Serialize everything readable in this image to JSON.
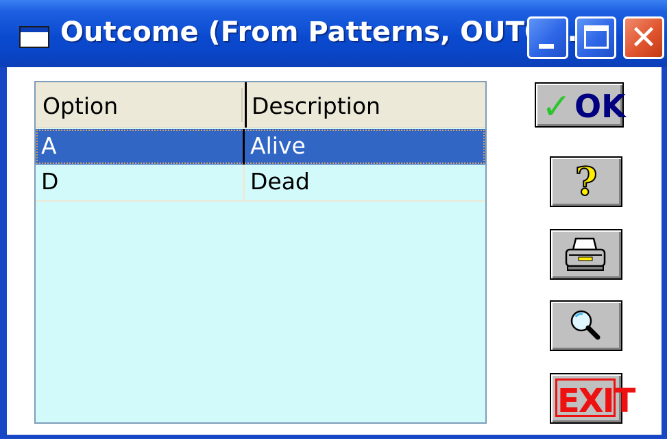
{
  "window": {
    "title": "Outcome (From Patterns, OUTCO..."
  },
  "grid": {
    "columns": [
      "Option",
      "Description"
    ],
    "rows": [
      {
        "option": "A",
        "description": "Alive",
        "selected": true
      },
      {
        "option": "D",
        "description": "Dead",
        "selected": false
      }
    ]
  },
  "buttons": {
    "ok_label": "OK",
    "ok_icon": "check-icon",
    "help_icon": "question-icon",
    "help_glyph": "?",
    "print_icon": "printer-icon",
    "find_icon": "magnifier-icon",
    "exit_label": "EXIT"
  },
  "colors": {
    "titlebar": "#0a4ad0",
    "grid_background": "#d3fafb",
    "selection": "#3166c4",
    "exit_red": "#ee1111",
    "ok_green": "#2ec42e"
  }
}
